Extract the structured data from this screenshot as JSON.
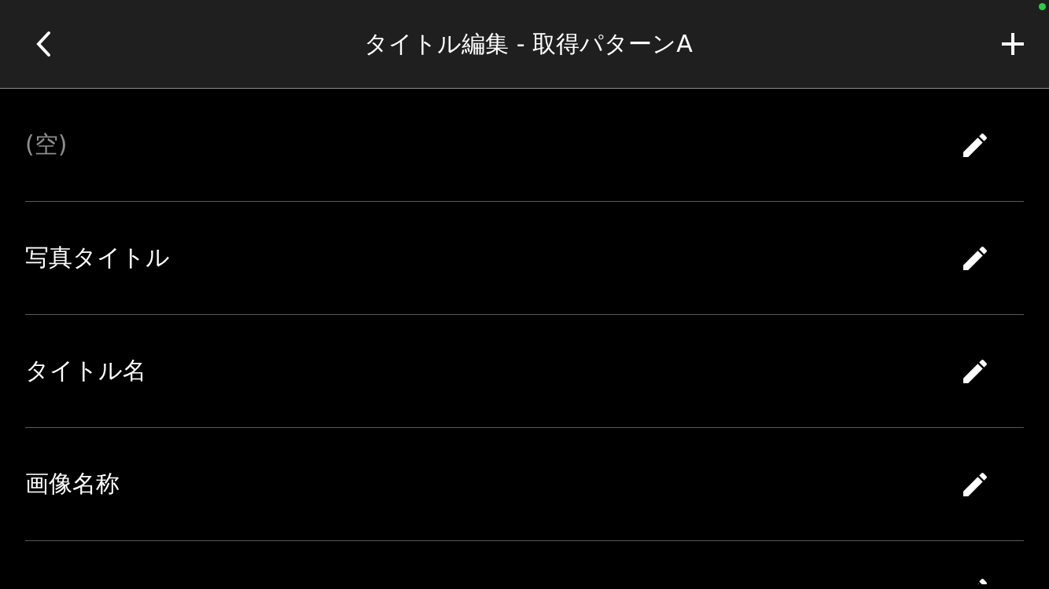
{
  "header": {
    "title": "タイトル編集 - 取得パターンA"
  },
  "items": [
    {
      "label": "(空)",
      "empty": true
    },
    {
      "label": "写真タイトル",
      "empty": false
    },
    {
      "label": "タイトル名",
      "empty": false
    },
    {
      "label": "画像名称",
      "empty": false
    },
    {
      "kind": "cut"
    }
  ]
}
